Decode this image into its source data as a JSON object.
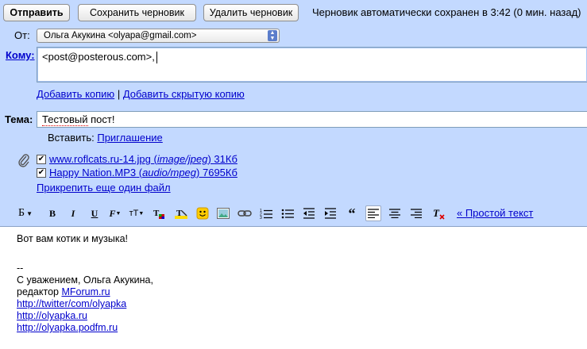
{
  "toolbar_top": {
    "send_label": "Отправить",
    "save_draft_label": "Сохранить черновик",
    "delete_draft_label": "Удалить черновик",
    "status": "Черновик автоматически сохранен в 3:42 (0 мин. назад)"
  },
  "from": {
    "label": "От:",
    "value": "Ольга Акукина <olyapa@gmail.com>"
  },
  "to": {
    "label": "Кому:",
    "value": "<post@posterous.com>,"
  },
  "cc_links": {
    "add_cc": "Добавить копию",
    "separator": "|",
    "add_bcc": "Добавить скрытую копию"
  },
  "subject": {
    "label": "Тема:",
    "value_misspelled": "Тестовый",
    "value_rest": " пост!"
  },
  "insert": {
    "label": "Вставить:",
    "invitation": "Приглашение"
  },
  "attachments": {
    "items": [
      {
        "name": "www.roflcats.ru-14.jpg",
        "type": "image/jpeg",
        "size": "31Кб",
        "checked": true
      },
      {
        "name": "Happy Nation.MP3",
        "type": "audio/mpeg",
        "size": "7695Кб",
        "checked": true
      }
    ],
    "attach_more": "Прикрепить еще один файл"
  },
  "format_toolbar": {
    "font_label": "Б",
    "plain_text_link": "« Простой текст",
    "icons": [
      "font-family-icon",
      "bold-icon",
      "italic-icon",
      "underline-icon",
      "font-color-icon",
      "font-size-icon",
      "text-highlight-icon",
      "remove-highlight-icon",
      "emoticon-icon",
      "insert-image-icon",
      "link-icon",
      "numbered-list-icon",
      "bulleted-list-icon",
      "outdent-icon",
      "indent-icon",
      "quote-icon",
      "align-left-icon",
      "align-center-icon",
      "align-right-icon",
      "remove-formatting-icon"
    ]
  },
  "body": {
    "greeting": "Вот вам котик и музыка!",
    "sig_sep": "--",
    "regards": "С уважением, Ольга Акукина,",
    "editor_prefix": "редактор ",
    "editor_link": "MForum.ru",
    "links": [
      "http://twitter/com/olyapka",
      "http://olyapka.ru",
      "http://olyapka.podfm.ru"
    ]
  },
  "colors": {
    "panel_bg": "#c3d9ff",
    "link": "#0000cc"
  }
}
